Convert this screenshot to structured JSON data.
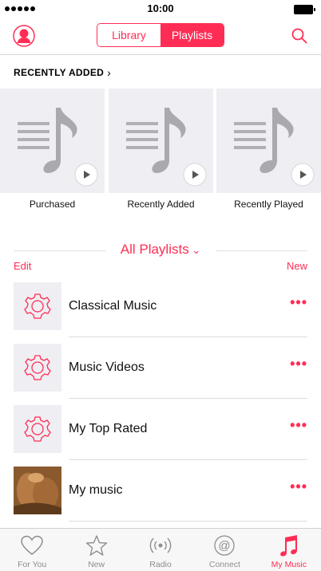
{
  "status": {
    "time": "10:00"
  },
  "nav": {
    "segments": [
      {
        "label": "Library",
        "selected": false
      },
      {
        "label": "Playlists",
        "selected": true
      }
    ],
    "accent_color": "#ff2d55"
  },
  "recently_added": {
    "header": "RECENTLY ADDED",
    "albums": [
      {
        "label": "Purchased"
      },
      {
        "label": "Recently Added"
      },
      {
        "label": "Recently Played"
      }
    ]
  },
  "playlists": {
    "title": "All Playlists",
    "edit_label": "Edit",
    "new_label": "New",
    "items": [
      {
        "title": "Classical Music",
        "icon": "gear-icon"
      },
      {
        "title": "Music Videos",
        "icon": "gear-icon"
      },
      {
        "title": "My Top Rated",
        "icon": "gear-icon"
      },
      {
        "title": "My music",
        "icon": "album-art"
      }
    ],
    "more_label": "•••"
  },
  "tabs": [
    {
      "label": "For You",
      "icon": "heart-icon",
      "active": false
    },
    {
      "label": "New",
      "icon": "star-icon",
      "active": false
    },
    {
      "label": "Radio",
      "icon": "radio-icon",
      "active": false
    },
    {
      "label": "Connect",
      "icon": "at-icon",
      "active": false
    },
    {
      "label": "My Music",
      "icon": "music-note-icon",
      "active": true
    }
  ]
}
